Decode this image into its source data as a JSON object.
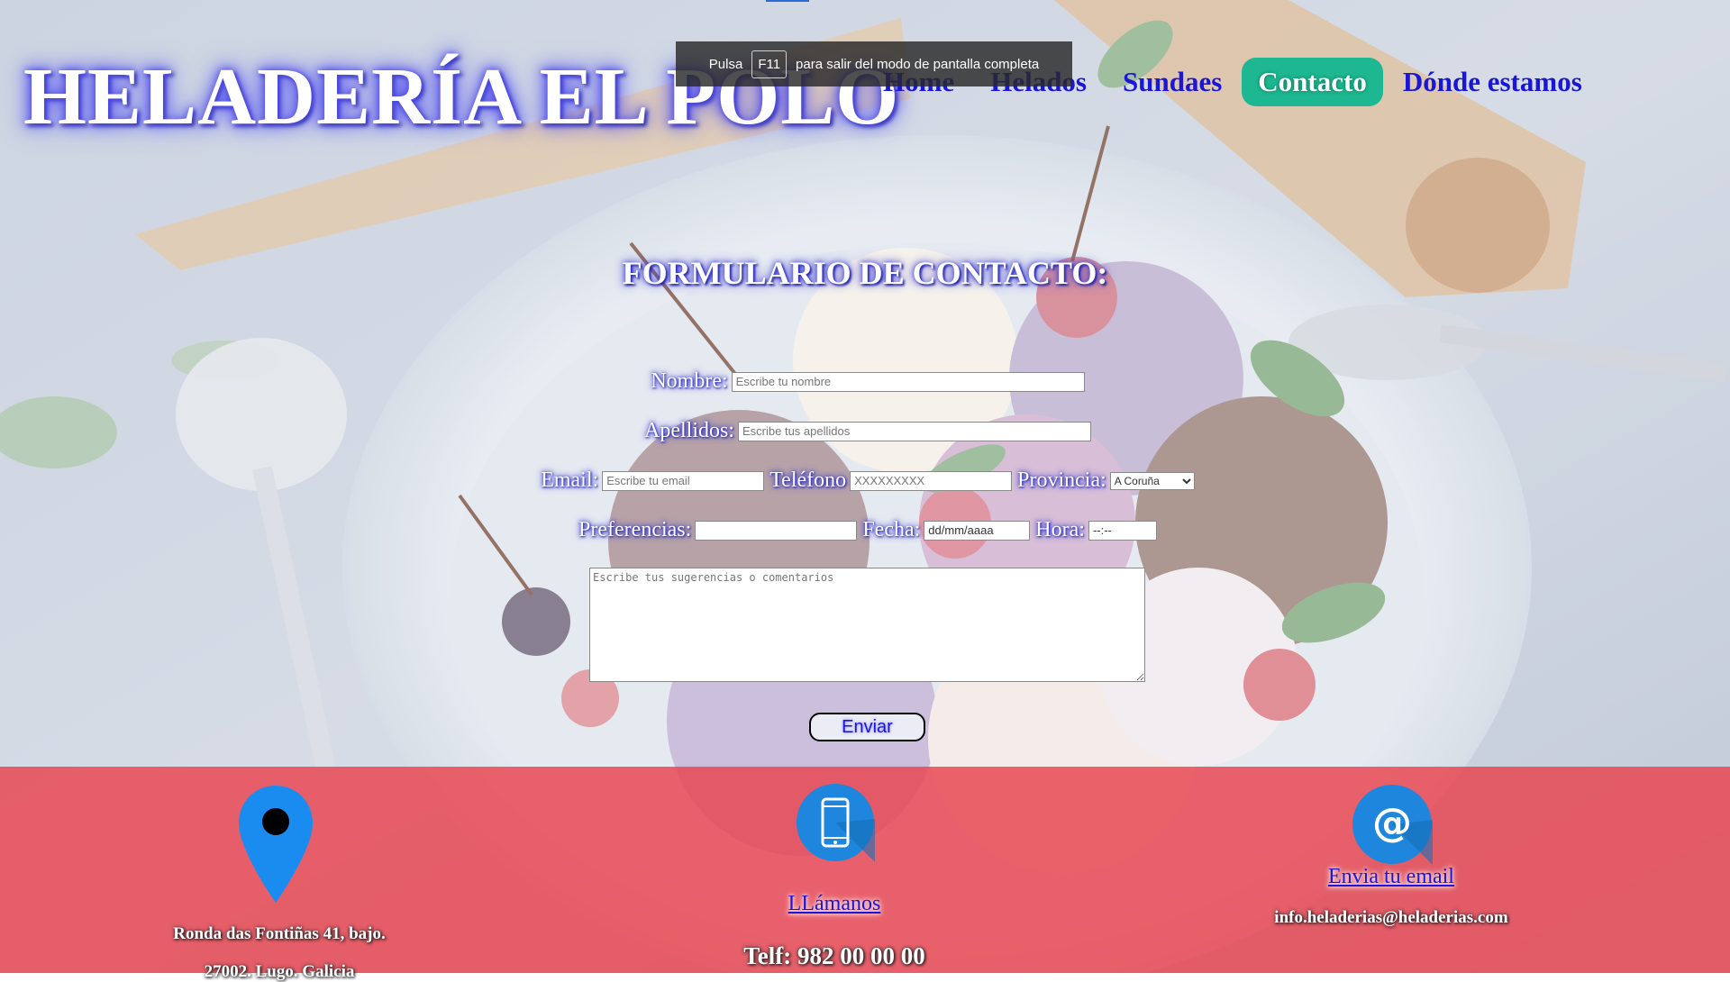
{
  "header": {
    "site_title": "HELADERÍA EL POLO",
    "nav": [
      {
        "label": "Home"
      },
      {
        "label": "Helados"
      },
      {
        "label": "Sundaes"
      },
      {
        "label": "Contacto",
        "active": true
      },
      {
        "label": "Dónde estamos"
      }
    ]
  },
  "fullscreen_notice": {
    "prefix": "Pulsa",
    "key": "F11",
    "suffix": "para salir del modo de pantalla completa"
  },
  "form": {
    "title": "FORMULARIO DE CONTACTO:",
    "nombre_label": "Nombre:",
    "nombre_placeholder": "Escribe tu nombre",
    "apellidos_label": "Apellidos:",
    "apellidos_placeholder": "Escribe tus apellidos",
    "email_label": "Email:",
    "email_placeholder": "Escribe tu email",
    "telefono_label": "Teléfono",
    "telefono_placeholder": "XXXXXXXXX",
    "provincia_label": "Provincia:",
    "provincia_selected": "A Coruña",
    "preferencias_label": "Preferencias:",
    "fecha_label": "Fecha:",
    "fecha_value": "dd/mm/aaaa",
    "hora_label": "Hora:",
    "hora_value": "--:--",
    "comments_placeholder": "Escribe tus sugerencias o comentarios",
    "submit_label": "Enviar"
  },
  "footer": {
    "address_line1": "Ronda das Fontiñas 41, bajo.",
    "address_line2": "27002. Lugo. Galicia",
    "call_link": "LLámanos",
    "phone": "Telf: 982 00 00 00",
    "email_link": "Envia tu email",
    "email": "info.heladerias@heladerias.com"
  },
  "colors": {
    "nav_text": "#1a16d6",
    "nav_active_bg": "#1db891",
    "footer_bg": "#e8424d",
    "glow": "#4b48e8"
  },
  "icons": [
    "map-pin-icon",
    "phone-icon",
    "at-sign-icon"
  ]
}
